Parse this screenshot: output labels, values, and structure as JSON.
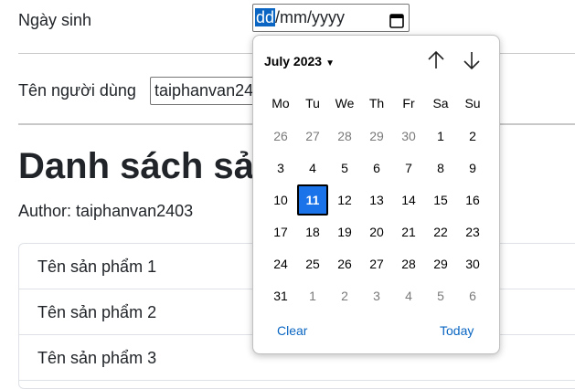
{
  "form": {
    "dob_label": "Ngày sinh",
    "dob_selected_segment": "dd",
    "dob_rest": "/mm/yyyy",
    "username_label": "Tên người dùng",
    "username_value": "taiphanvan2403"
  },
  "main": {
    "heading": "Danh sách sản phẩm",
    "author": "Author: taiphanvan2403",
    "products": [
      "Tên sản phẩm 1",
      "Tên sản phẩm 2",
      "Tên sản phẩm 3"
    ]
  },
  "calendar": {
    "month_year": "July 2023",
    "weekdays": [
      "Mo",
      "Tu",
      "We",
      "Th",
      "Fr",
      "Sa",
      "Su"
    ],
    "days": [
      [
        "26",
        "27",
        "28",
        "29",
        "30",
        "1",
        "2"
      ],
      [
        "3",
        "4",
        "5",
        "6",
        "7",
        "8",
        "9"
      ],
      [
        "10",
        "11",
        "12",
        "13",
        "14",
        "15",
        "16"
      ],
      [
        "17",
        "18",
        "19",
        "20",
        "21",
        "22",
        "23"
      ],
      [
        "24",
        "25",
        "26",
        "27",
        "28",
        "29",
        "30"
      ],
      [
        "31",
        "1",
        "2",
        "3",
        "4",
        "5",
        "6"
      ]
    ],
    "selected_day": "11",
    "clear_label": "Clear",
    "today_label": "Today"
  },
  "colors": {
    "accent": "#1a73e8",
    "link": "#0a66c2",
    "muted_day": "#7a7a7a"
  }
}
